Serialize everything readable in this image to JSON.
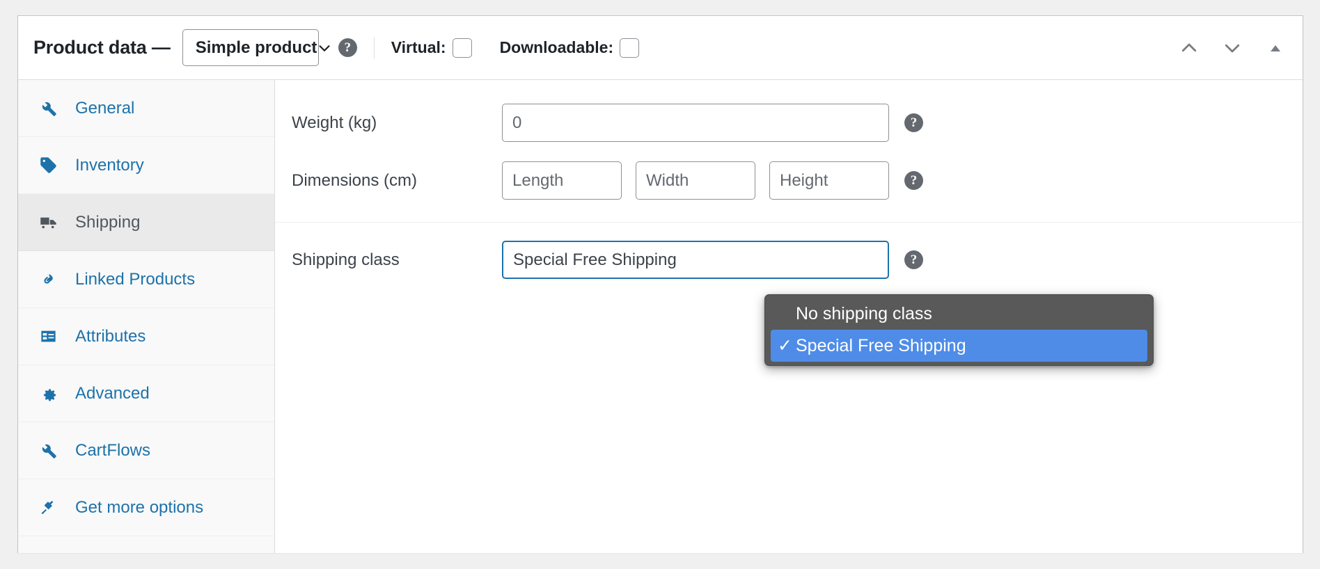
{
  "header": {
    "title": "Product data —",
    "product_type": {
      "selected": "Simple product",
      "icon": "chevron-down-icon"
    },
    "help_icon": "?",
    "virtual": {
      "label": "Virtual:",
      "checked": false
    },
    "downloadable": {
      "label": "Downloadable:",
      "checked": false
    },
    "controls": [
      {
        "name": "move-up",
        "icon": "chevron-up-icon"
      },
      {
        "name": "move-down",
        "icon": "chevron-down-icon"
      },
      {
        "name": "toggle-panel",
        "icon": "triangle-up-icon"
      }
    ]
  },
  "tabs": [
    {
      "label": "General",
      "icon": "wrench-icon",
      "active": false
    },
    {
      "label": "Inventory",
      "icon": "tag-icon",
      "active": false
    },
    {
      "label": "Shipping",
      "icon": "truck-icon",
      "active": true
    },
    {
      "label": "Linked Products",
      "icon": "link-icon",
      "active": false
    },
    {
      "label": "Attributes",
      "icon": "list-form-icon",
      "active": false
    },
    {
      "label": "Advanced",
      "icon": "gear-icon",
      "active": false
    },
    {
      "label": "CartFlows",
      "icon": "wrench-icon",
      "active": false
    },
    {
      "label": "Get more options",
      "icon": "plug-icon",
      "active": false
    }
  ],
  "fields": {
    "weight": {
      "label": "Weight (kg)",
      "value": "",
      "placeholder": "0",
      "help_icon": "?"
    },
    "dimensions": {
      "label": "Dimensions (cm)",
      "inputs": [
        {
          "name": "length",
          "value": "",
          "placeholder": "Length"
        },
        {
          "name": "width",
          "value": "",
          "placeholder": "Width"
        },
        {
          "name": "height",
          "value": "",
          "placeholder": "Height"
        }
      ],
      "help_icon": "?"
    },
    "shipping_class": {
      "label": "Shipping class",
      "selected": "Special Free Shipping",
      "help_icon": "?",
      "options": [
        {
          "label": "No shipping class",
          "selected": false,
          "check": ""
        },
        {
          "label": "Special Free Shipping",
          "selected": true,
          "check": "✓"
        }
      ]
    }
  },
  "colors": {
    "link_blue": "#1d72aa",
    "dropdown_bg": "#595959",
    "dropdown_highlight": "#4e8ce8",
    "focus_border": "#1d72aa",
    "page_bg": "#f0f0f1",
    "sidebar_bg": "#f9f9f9",
    "active_tab_bg": "#eaeaea"
  }
}
